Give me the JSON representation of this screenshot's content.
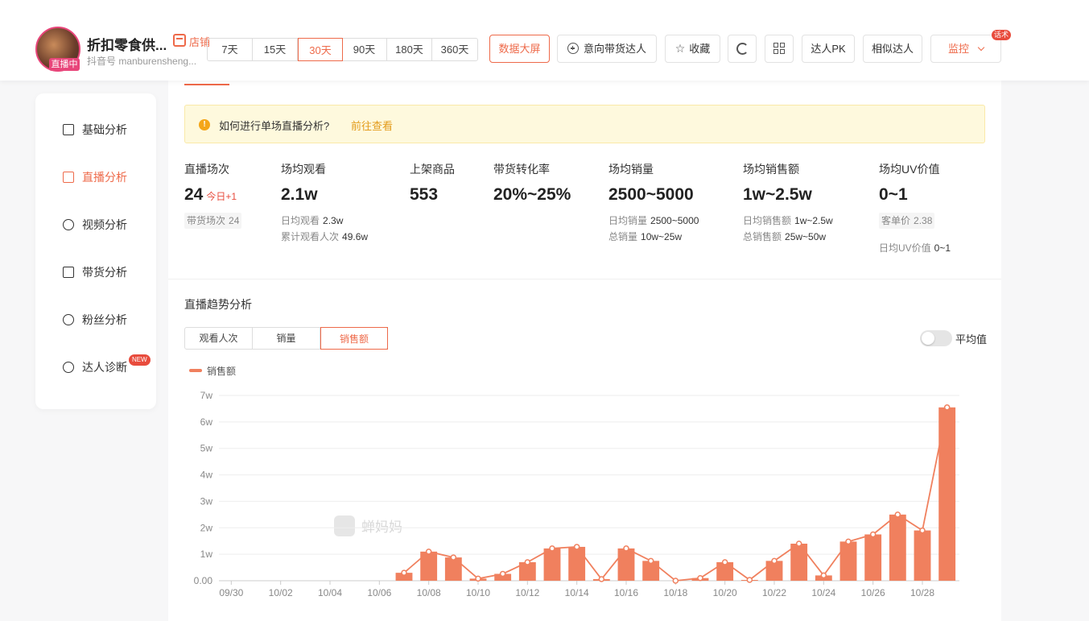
{
  "header": {
    "live_badge": "直播中",
    "shop_name": "折扣零食供...",
    "shop_tag": "店铺",
    "douyin_id": "抖音号 manburensheng...",
    "day_ranges": [
      "7天",
      "15天",
      "30天",
      "90天",
      "180天",
      "360天"
    ],
    "active_range": "30天",
    "buttons": {
      "big_screen": "数据大屏",
      "intended_creator": "意向带货达人",
      "favorite": "收藏",
      "pk": "达人PK",
      "similar": "相似达人",
      "monitor": "监控"
    },
    "monitor_badge": "话术"
  },
  "sidebar": {
    "items": [
      {
        "label": "基础分析",
        "icon": "bar-chart-icon"
      },
      {
        "label": "直播分析",
        "icon": "live-tv-icon"
      },
      {
        "label": "视频分析",
        "icon": "play-circle-icon"
      },
      {
        "label": "带货分析",
        "icon": "shopping-bag-icon"
      },
      {
        "label": "粉丝分析",
        "icon": "user-icon"
      },
      {
        "label": "达人诊断",
        "icon": "pulse-icon"
      }
    ],
    "active": "直播分析",
    "new_badge": "NEW"
  },
  "notice": {
    "text": "如何进行单场直播分析?",
    "link": "前往查看"
  },
  "stats": {
    "sessions": {
      "label": "直播场次",
      "value": "24",
      "today": "今日+1",
      "sub_label": "带货场次",
      "sub_value": "24"
    },
    "avg_views": {
      "label": "场均观看",
      "value": "2.1w",
      "sub1_label": "日均观看",
      "sub1_value": "2.3w",
      "sub2_label": "累计观看人次",
      "sub2_value": "49.6w"
    },
    "products": {
      "label": "上架商品",
      "value": "553"
    },
    "conversion": {
      "label": "带货转化率",
      "value": "20%~25%"
    },
    "avg_sales_volume": {
      "label": "场均销量",
      "value": "2500~5000",
      "sub1_label": "日均销量",
      "sub1_value": "2500~5000",
      "sub2_label": "总销量",
      "sub2_value": "10w~25w"
    },
    "avg_sales_amount": {
      "label": "场均销售额",
      "value": "1w~2.5w",
      "sub1_label": "日均销售额",
      "sub1_value": "1w~2.5w",
      "sub2_label": "总销售额",
      "sub2_value": "25w~50w"
    },
    "uv_value": {
      "label": "场均UV价值",
      "value": "0~1",
      "sub1_label": "客单价",
      "sub1_value": "2.38",
      "sub2_label": "日均UV价值",
      "sub2_value": "0~1"
    }
  },
  "trend": {
    "title": "直播趋势分析",
    "tabs": [
      "观看人次",
      "销量",
      "销售额"
    ],
    "active_tab": "销售额",
    "average_toggle_label": "平均值",
    "watermark": "蝉妈妈"
  },
  "chart_data": {
    "type": "bar",
    "title": "",
    "legend": [
      "销售额"
    ],
    "color": "#f0805e",
    "y_ticks": [
      "0.00",
      "1w",
      "2w",
      "3w",
      "4w",
      "5w",
      "6w",
      "7w"
    ],
    "ylim": [
      0,
      70000
    ],
    "x_tick_labels": [
      "09/30",
      "10/02",
      "10/04",
      "10/06",
      "10/08",
      "10/10",
      "10/12",
      "10/14",
      "10/16",
      "10/18",
      "10/20",
      "10/22",
      "10/24",
      "10/26",
      "10/28"
    ],
    "categories": [
      "09/30",
      "10/01",
      "10/02",
      "10/03",
      "10/04",
      "10/05",
      "10/06",
      "10/07",
      "10/08",
      "10/09",
      "10/10",
      "10/11",
      "10/12",
      "10/13",
      "10/14",
      "10/15",
      "10/16",
      "10/17",
      "10/18",
      "10/19",
      "10/20",
      "10/21",
      "10/22",
      "10/23",
      "10/24",
      "10/25",
      "10/26",
      "10/27",
      "10/28",
      "10/29"
    ],
    "series": [
      {
        "name": "销售额",
        "values": [
          0,
          0,
          0,
          0,
          0,
          0,
          0,
          3000,
          11000,
          8800,
          800,
          2600,
          7000,
          12200,
          12800,
          600,
          12200,
          7500,
          0,
          1000,
          7000,
          300,
          7500,
          14000,
          2000,
          14800,
          17500,
          25000,
          19000,
          65500
        ]
      }
    ]
  }
}
